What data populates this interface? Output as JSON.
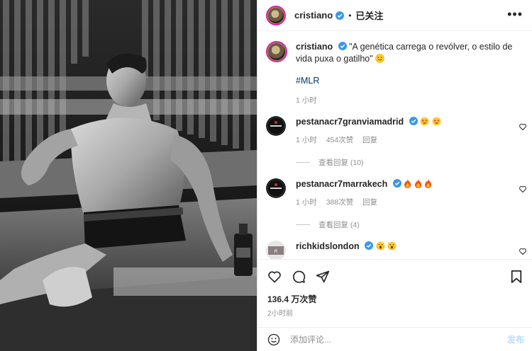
{
  "header": {
    "username": "cristiano",
    "separator": "•",
    "follow_label": "已关注",
    "more_label": "•••"
  },
  "caption": {
    "username": "cristiano",
    "text": "\"A genética carrega o revólver, o estilo de vida puxa o gatilho\"",
    "hashtag": "#MLR",
    "age": "1 小时"
  },
  "comments": [
    {
      "username": "pestanacr7granviamadrid",
      "emoji": [
        "star-struck",
        "star-struck"
      ],
      "age": "1 小时",
      "likes": "454次赞",
      "reply_label": "回复",
      "view_replies": "查看回复 (10)"
    },
    {
      "username": "pestanacr7marrakech",
      "emoji": [
        "fire",
        "fire",
        "fire"
      ],
      "age": "1 小时",
      "likes": "388次赞",
      "reply_label": "回复",
      "view_replies": "查看回复 (4)"
    },
    {
      "username": "richkidslondon",
      "emoji": [
        "screaming-face",
        "screaming-face"
      ]
    }
  ],
  "actions": {
    "likes": "136.4 万次赞",
    "time": "2小时前"
  },
  "comment_box": {
    "placeholder": "添加评论...",
    "post_label": "发布"
  },
  "colors": {
    "verified": "#3897f0",
    "link": "#00376b",
    "muted": "#8e8e8e",
    "post_button": "#b2dffc"
  },
  "icons": [
    "verified-badge-icon",
    "more-options-icon",
    "heart-icon",
    "comment-icon",
    "share-icon",
    "bookmark-icon",
    "emoji-icon"
  ]
}
